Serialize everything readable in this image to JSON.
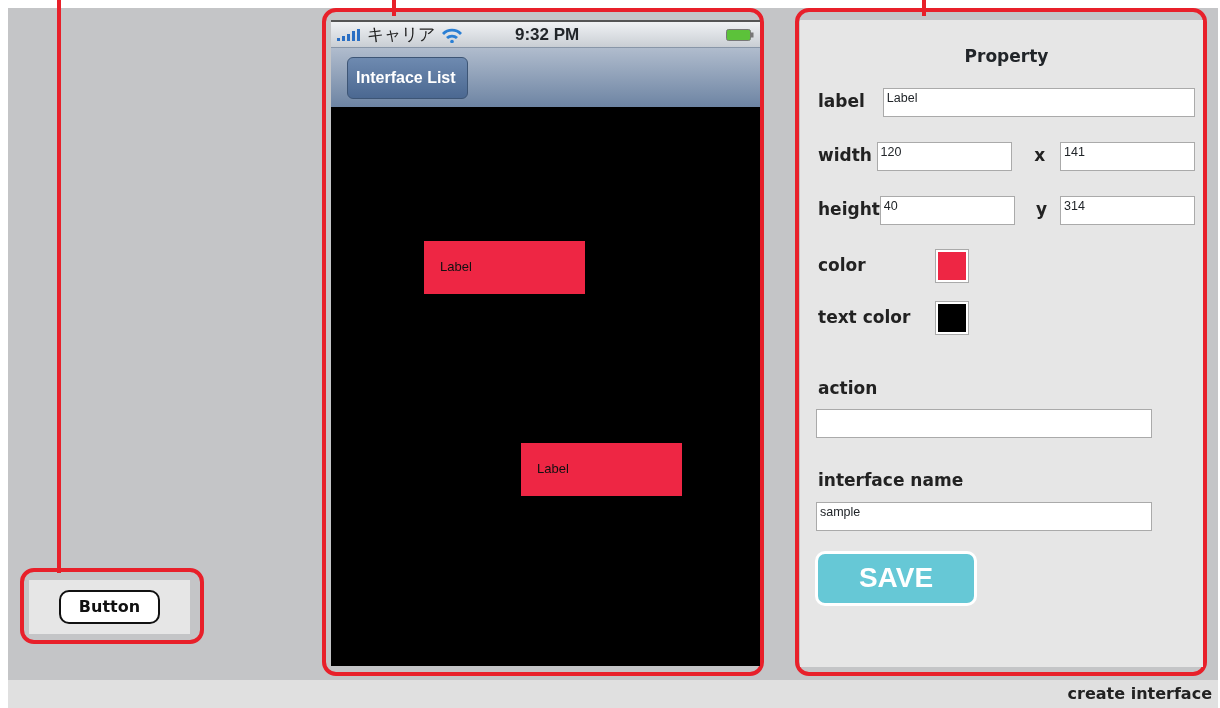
{
  "palette": {
    "items": [
      {
        "kind": "button",
        "text": "Button"
      }
    ]
  },
  "phone": {
    "status_bar": {
      "carrier": "キャリア",
      "time": "9:32 PM"
    },
    "nav_bar": {
      "back_button": "Interface List"
    },
    "canvas": {
      "items": [
        {
          "kind": "label",
          "text": "Label"
        },
        {
          "kind": "label",
          "text": "Label"
        }
      ]
    }
  },
  "property": {
    "title": "Property",
    "rows": [
      {
        "kind": "text",
        "fields": [
          {
            "label": "label",
            "value": "Label"
          }
        ]
      },
      {
        "kind": "pair",
        "fields": [
          {
            "label": "width",
            "value": "120"
          },
          {
            "label": "x",
            "value": "141"
          }
        ]
      },
      {
        "kind": "pair",
        "fields": [
          {
            "label": "height",
            "value": "40"
          },
          {
            "label": "y",
            "value": "314"
          }
        ]
      },
      {
        "kind": "swatch",
        "fields": [
          {
            "label": "color",
            "color": "#ee2644"
          }
        ]
      },
      {
        "kind": "swatch",
        "fields": [
          {
            "label": "text color",
            "color": "#000000"
          }
        ]
      },
      {
        "kind": "block",
        "fields": [
          {
            "label": "action"
          }
        ]
      },
      {
        "kind": "block",
        "fields": [
          {
            "label": "interface name",
            "value": "sample"
          }
        ]
      }
    ],
    "save_button": "SAVE"
  },
  "footer": {
    "text": "create interface"
  }
}
